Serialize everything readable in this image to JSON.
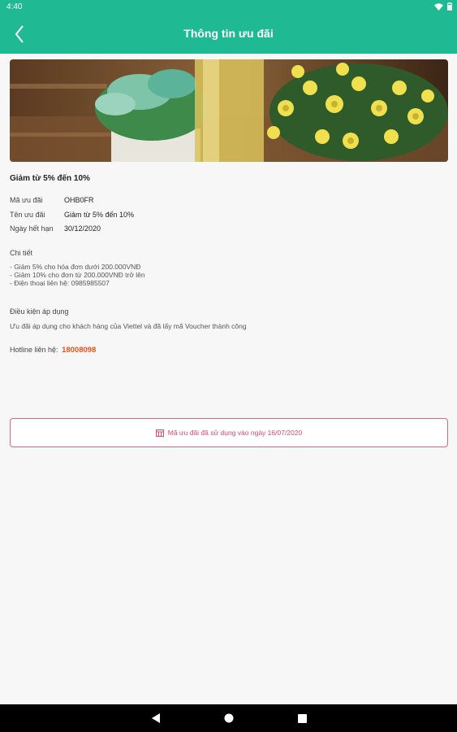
{
  "status_bar": {
    "time": "4:40",
    "wifi_icon": "wifi-icon",
    "battery_icon": "battery-icon"
  },
  "app_bar": {
    "title": "Thông tin ưu đãi",
    "back_icon": "chevron-left-icon"
  },
  "promo": {
    "title": "Giảm từ 5% đến 10%",
    "fields": [
      {
        "label": "Mã ưu đãi",
        "value": "OHB0FR"
      },
      {
        "label": "Tên ưu đãi",
        "value": "Giảm từ 5% đến 10%"
      },
      {
        "label": "Ngày hết hạn",
        "value": "30/12/2020"
      }
    ],
    "detail_title": "Chi tiết",
    "detail_text": "- Giảm 5% cho hóa đơn dưới 200.000VNĐ\n- Giảm 10% cho đơn từ 200.000VNĐ trở lên\n- Điện thoại liên hệ: 0985985507",
    "condition_title": "Điều kiện áp dụng",
    "condition_text": "Ưu đãi áp dụng cho khách hàng của Viettel và đã lấy mã Voucher thành công",
    "hotline_label": "Hotline liên hệ:",
    "hotline_number": "18008098"
  },
  "used_notice": {
    "text": "Mã ưu đãi đã sử dụng vào ngày 16/07/2020",
    "icon": "ticket-icon"
  },
  "nav_bar": {
    "back": "back-triangle-icon",
    "home": "home-circle-icon",
    "recents": "recents-square-icon"
  },
  "colors": {
    "primary": "#1fb993",
    "accent_red": "#e0476b",
    "hotline": "#e8541a"
  }
}
